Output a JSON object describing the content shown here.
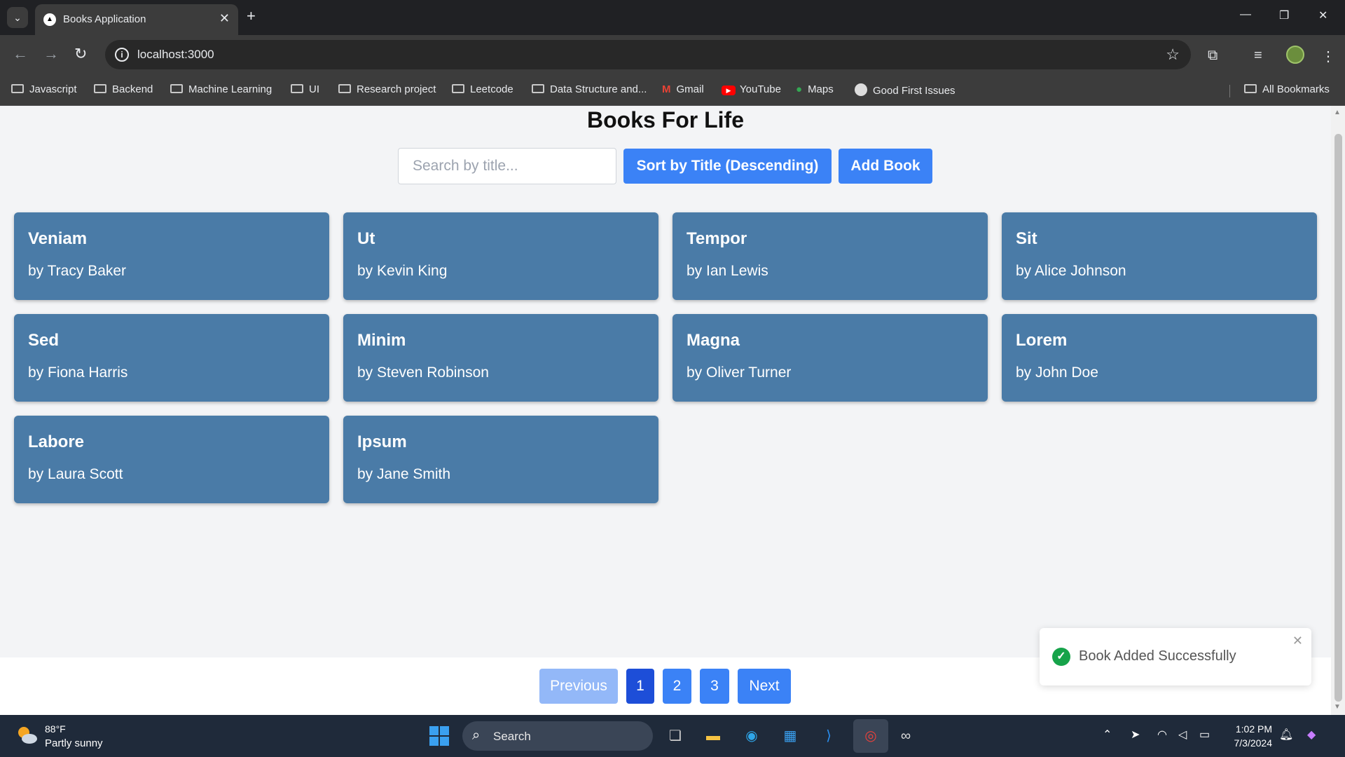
{
  "browser": {
    "tab_title": "Books Application",
    "url": "localhost:3000",
    "bookmarks": [
      {
        "label": "Javascript",
        "type": "folder"
      },
      {
        "label": "Backend",
        "type": "folder"
      },
      {
        "label": "Machine Learning",
        "type": "folder"
      },
      {
        "label": "UI",
        "type": "folder"
      },
      {
        "label": "Research project",
        "type": "folder"
      },
      {
        "label": "Leetcode",
        "type": "folder"
      },
      {
        "label": "Data Structure and...",
        "type": "folder"
      },
      {
        "label": "Gmail",
        "type": "gmail-icon"
      },
      {
        "label": "YouTube",
        "type": "youtube-icon"
      },
      {
        "label": "Maps",
        "type": "maps-icon"
      },
      {
        "label": "Good First Issues",
        "type": "github-icon"
      }
    ],
    "all_bookmarks": "All Bookmarks"
  },
  "app": {
    "title": "Books For Life",
    "search_placeholder": "Search by title...",
    "sort_label": "Sort by Title (Descending)",
    "add_label": "Add Book",
    "books": [
      {
        "title": "Veniam",
        "author": "by Tracy Baker"
      },
      {
        "title": "Ut",
        "author": "by Kevin King"
      },
      {
        "title": "Tempor",
        "author": "by Ian Lewis"
      },
      {
        "title": "Sit",
        "author": "by Alice Johnson"
      },
      {
        "title": "Sed",
        "author": "by Fiona Harris"
      },
      {
        "title": "Minim",
        "author": "by Steven Robinson"
      },
      {
        "title": "Magna",
        "author": "by Oliver Turner"
      },
      {
        "title": "Lorem",
        "author": "by John Doe"
      },
      {
        "title": "Labore",
        "author": "by Laura Scott"
      },
      {
        "title": "Ipsum",
        "author": "by Jane Smith"
      }
    ],
    "pagination": {
      "previous": "Previous",
      "pages": [
        "1",
        "2",
        "3"
      ],
      "current": "1",
      "next": "Next"
    },
    "toast": "Book Added Successfully",
    "colors": {
      "primary": "#3b82f6",
      "card": "#4a7ba7",
      "active_page": "#1d4ed8",
      "success": "#16a34a"
    }
  },
  "taskbar": {
    "temperature": "88°F",
    "weather": "Partly sunny",
    "search": "Search",
    "time": "1:02 PM",
    "date": "7/3/2024"
  }
}
